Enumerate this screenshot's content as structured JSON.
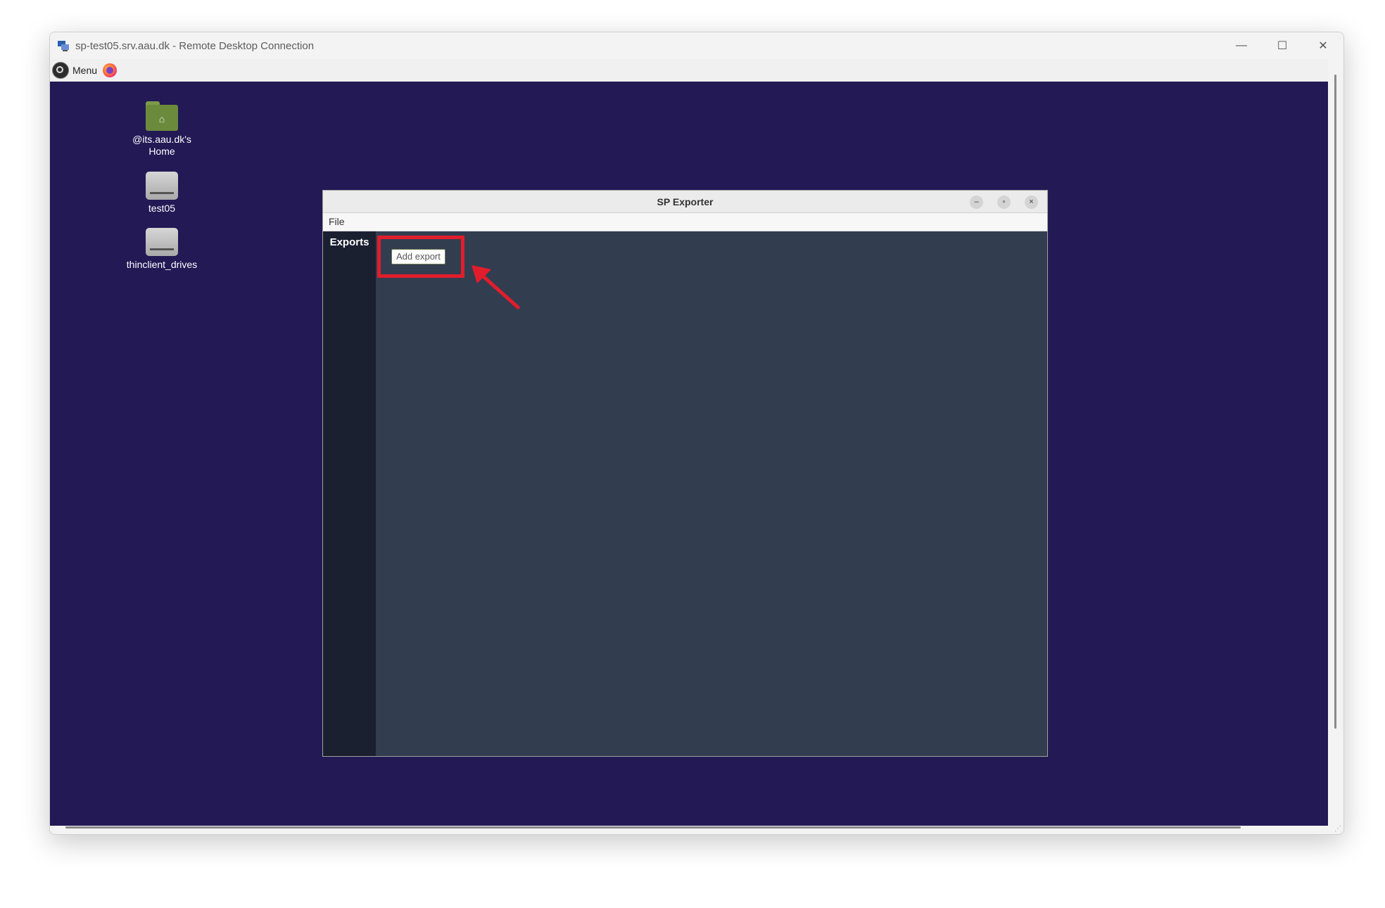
{
  "rdp": {
    "title": "sp-test05.srv.aau.dk - Remote Desktop Connection",
    "minimize": "—",
    "maximize": "☐",
    "close": "✕"
  },
  "panel": {
    "menu_label": "Menu"
  },
  "desktop_icons": [
    {
      "label_line1": "@its.aau.dk's",
      "label_line2": "Home",
      "icon": "home-folder-icon"
    },
    {
      "label": "test05",
      "icon": "drive-icon"
    },
    {
      "label": "thinclient_drives",
      "icon": "drive-icon"
    }
  ],
  "app": {
    "title": "SP Exporter",
    "minimize": "–",
    "maximize": "▫",
    "close": "×",
    "menu": {
      "file": "File"
    },
    "sidebar": {
      "exports_tab": "Exports"
    },
    "content": {
      "add_export_label": "Add export"
    },
    "annotation_color": "#e21d2b"
  },
  "colors": {
    "desktop_bg": "#221955",
    "app_content_bg": "#333d50",
    "app_sidebar_bg": "#1b2031"
  }
}
